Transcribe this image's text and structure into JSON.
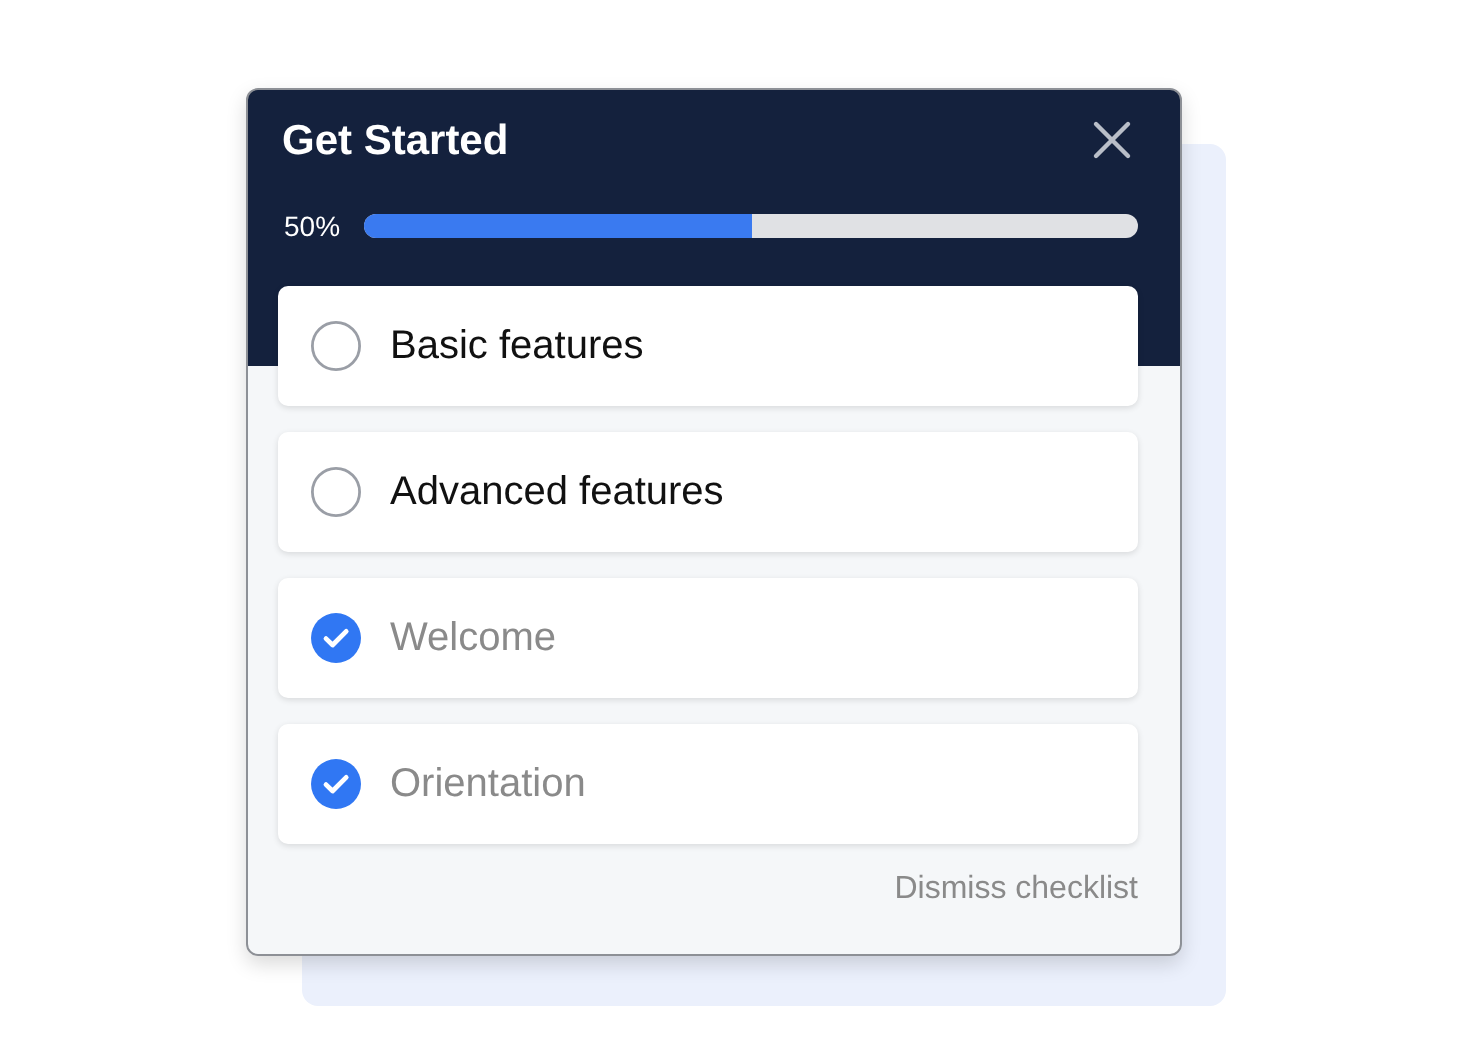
{
  "title": "Get Started",
  "progress": {
    "reading": "50%",
    "level": 0.5
  },
  "items": [
    {
      "label": "Basic features",
      "checked": false
    },
    {
      "label": "Advanced features",
      "checked": false
    },
    {
      "label": "Welcome",
      "checked": true
    },
    {
      "label": "Orientation",
      "checked": true
    }
  ],
  "dismiss": "Dismiss checklist"
}
